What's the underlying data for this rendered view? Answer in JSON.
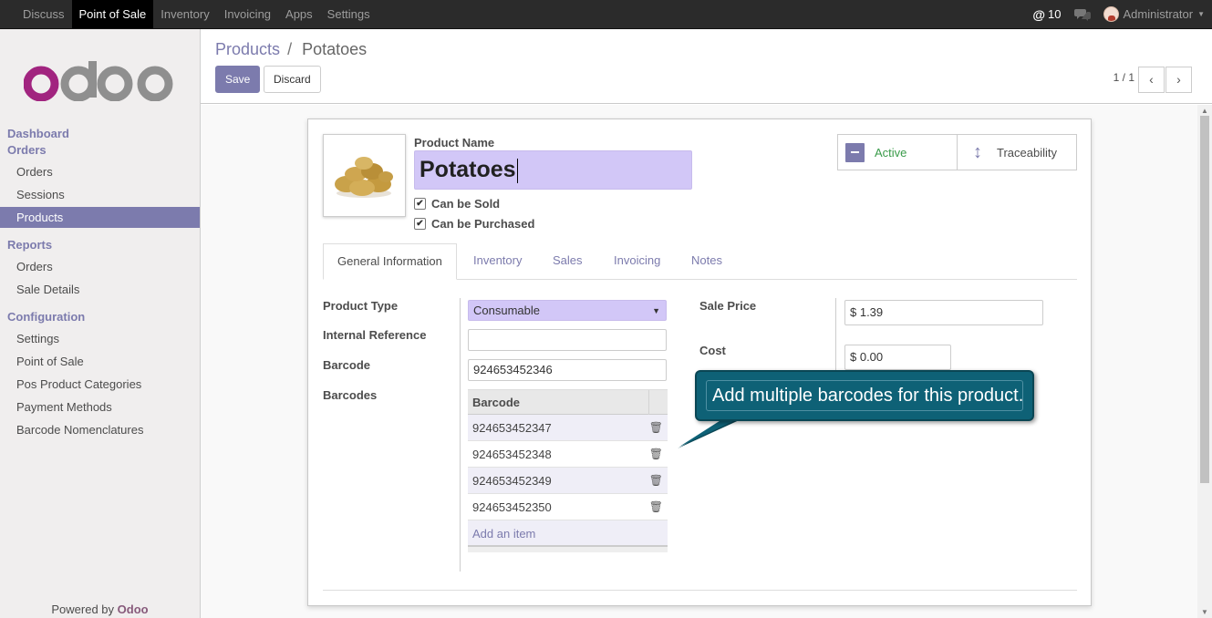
{
  "topbar": {
    "menu": [
      "Discuss",
      "Point of Sale",
      "Inventory",
      "Invoicing",
      "Apps",
      "Settings"
    ],
    "notif_count": "10",
    "user": "Administrator"
  },
  "sidebar": {
    "logo_text": "odoo",
    "dashboard": "Dashboard",
    "orders_head": "Orders",
    "orders_items": [
      "Orders",
      "Sessions",
      "Products"
    ],
    "reports_head": "Reports",
    "reports_items": [
      "Orders",
      "Sale Details"
    ],
    "config_head": "Configuration",
    "config_items": [
      "Settings",
      "Point of Sale",
      "Pos Product Categories",
      "Payment Methods",
      "Barcode Nomenclatures"
    ],
    "powered_prefix": "Powered by",
    "powered_brand": "Odoo"
  },
  "control_panel": {
    "breadcrumb_parent": "Products",
    "breadcrumb_sep": "/",
    "breadcrumb_current": "Potatoes",
    "save_label": "Save",
    "discard_label": "Discard",
    "pager": "1 / 1"
  },
  "form": {
    "product_name_label": "Product Name",
    "product_name": "Potatoes",
    "can_be_sold": "Can be Sold",
    "can_be_purchased": "Can be Purchased",
    "active_label": "Active",
    "traceability_label": "Traceability",
    "tabs": [
      "General Information",
      "Inventory",
      "Sales",
      "Invoicing",
      "Notes"
    ],
    "product_type_label": "Product Type",
    "product_type_value": "Consumable",
    "internal_ref_label": "Internal Reference",
    "internal_ref_value": "",
    "barcode_label": "Barcode",
    "barcode_value": "924653452346",
    "barcodes_label": "Barcodes",
    "barcodes_column": "Barcode",
    "barcodes": [
      "924653452347",
      "924653452348",
      "924653452349",
      "924653452350"
    ],
    "add_item": "Add an item",
    "sale_price_label": "Sale Price",
    "sale_price_value": "$ 1.39",
    "cost_label": "Cost",
    "cost_value": "$ 0.00"
  },
  "tooltip": {
    "text": "Add multiple barcodes for this product."
  },
  "colors": {
    "brand": "#7c7bad",
    "topbar": "#2b2b2b",
    "tooltip": "#0e6176"
  }
}
